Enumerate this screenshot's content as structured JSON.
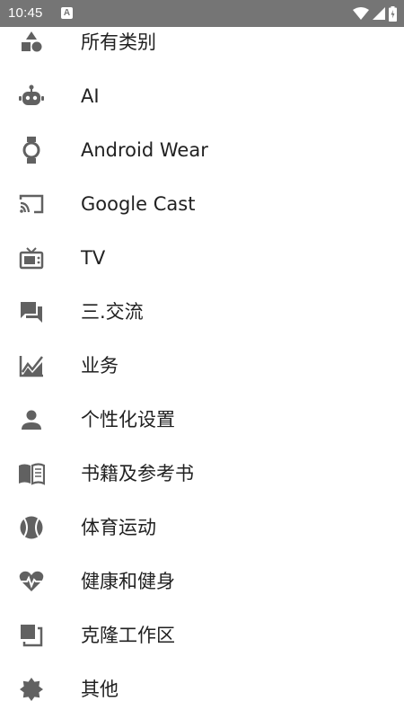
{
  "status_bar": {
    "time": "10:45",
    "notification_icon_text": "A",
    "icons": [
      "wifi-icon",
      "cell-signal-icon",
      "battery-charging-icon"
    ]
  },
  "icon_color": "#616161",
  "categories": [
    {
      "label": "所有类别",
      "icon": "shapes-icon"
    },
    {
      "label": "AI",
      "icon": "robot-icon"
    },
    {
      "label": "Android Wear",
      "icon": "watch-icon"
    },
    {
      "label": "Google Cast",
      "icon": "cast-icon"
    },
    {
      "label": "TV",
      "icon": "tv-icon"
    },
    {
      "label": "三.交流",
      "icon": "chat-icon"
    },
    {
      "label": "业务",
      "icon": "chart-icon"
    },
    {
      "label": "个性化设置",
      "icon": "person-icon"
    },
    {
      "label": "书籍及参考书",
      "icon": "book-icon"
    },
    {
      "label": "体育运动",
      "icon": "sports-ball-icon"
    },
    {
      "label": "健康和健身",
      "icon": "heart-pulse-icon"
    },
    {
      "label": "克隆工作区",
      "icon": "clone-icon"
    },
    {
      "label": "其他",
      "icon": "badge-icon"
    }
  ]
}
